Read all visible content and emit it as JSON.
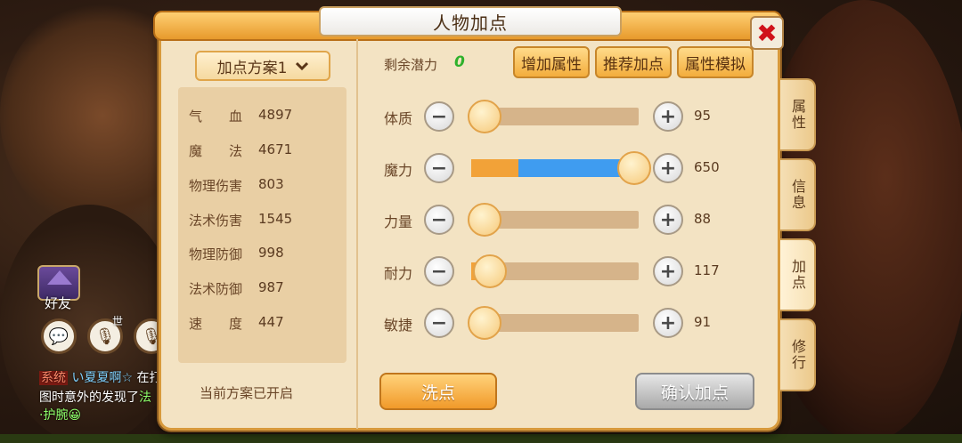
{
  "dialog": {
    "title": "人物加点",
    "close_symbol": "✖"
  },
  "left_panel": {
    "plan_dropdown_label": "加点方案1",
    "plan_dropdown_icon": "chevron-down-icon",
    "stats": [
      {
        "label": "气　　血",
        "value": "4897"
      },
      {
        "label": "魔　　法",
        "value": "4671"
      },
      {
        "label": "物理伤害",
        "value": "803"
      },
      {
        "label": "法术伤害",
        "value": "1545"
      },
      {
        "label": "物理防御",
        "value": "998"
      },
      {
        "label": "法术防御",
        "value": "987"
      },
      {
        "label": "速　　度",
        "value": "447"
      }
    ],
    "plan_status": "当前方案已开启"
  },
  "right_panel": {
    "remaining_label": "剩余潜力",
    "remaining_value": "0",
    "buttons": {
      "add_attribute": "增加属性",
      "recommended": "推荐加点",
      "simulate": "属性模拟"
    },
    "attributes": [
      {
        "label": "体质",
        "value": "95",
        "level": 0.0,
        "added": 0.0
      },
      {
        "label": "魔力",
        "value": "650",
        "level": 0.28,
        "added": 0.66
      },
      {
        "label": "力量",
        "value": "88",
        "level": 0.0,
        "added": 0.0
      },
      {
        "label": "耐力",
        "value": "117",
        "level": 0.08,
        "added": 0.0
      },
      {
        "label": "敏捷",
        "value": "91",
        "level": 0.0,
        "added": 0.0
      }
    ],
    "minus_symbol": "−",
    "plus_symbol": "+",
    "wash_button": "洗点",
    "confirm_button": "确认加点"
  },
  "side_tabs": [
    {
      "label": "属性",
      "active": false
    },
    {
      "label": "信息",
      "active": false
    },
    {
      "label": "加点",
      "active": true
    },
    {
      "label": "修行",
      "active": false
    }
  ],
  "overlay": {
    "friend_label": "好友",
    "world_label": "世",
    "chat_icon": "chat-bubble-icon",
    "mic_icon": "microphone-icon",
    "chat_lines": [
      {
        "tag": "系统",
        "name": "い夏夏啊☆",
        "text": "在打"
      },
      {
        "text_prefix": "图时意外的发现了",
        "item": "法"
      },
      {
        "item": "·护腕😀"
      }
    ]
  },
  "colors": {
    "panel_bg": "#f3e3c3",
    "accent_orange": "#f2a238",
    "accent_blue": "#3f9cf0",
    "remaining_green": "#2fb12c",
    "close_red": "#d0121a"
  }
}
